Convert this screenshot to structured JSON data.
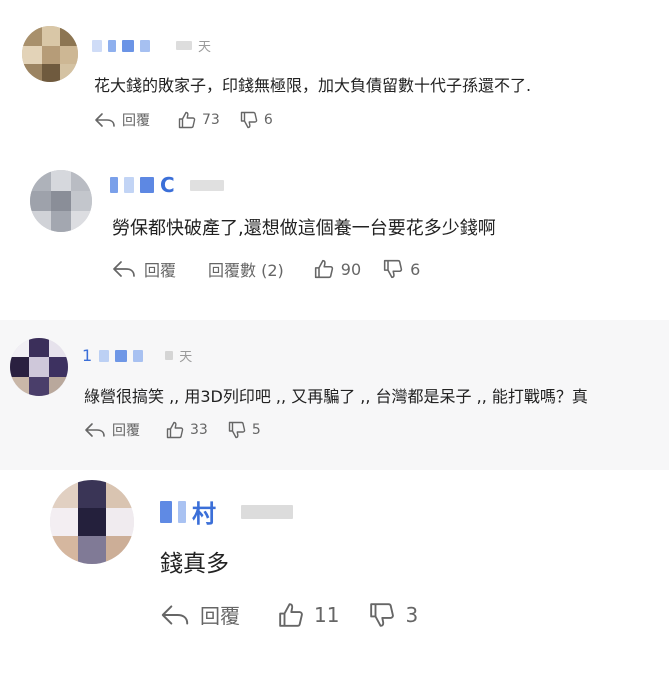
{
  "comments": [
    {
      "user": {
        "name": "",
        "time": "天"
      },
      "text": "花大錢的敗家子，印錢無極限，加大負債留數十代子孫還不了.",
      "reply_label": "回覆",
      "replies_label": "",
      "likes": "73",
      "dislikes": "6"
    },
    {
      "user": {
        "name": "C",
        "time": ""
      },
      "text": "勞保都快破產了,還想做這個養一台要花多少錢啊",
      "reply_label": "回覆",
      "replies_label": "回覆數 (2)",
      "likes": "90",
      "dislikes": "6"
    },
    {
      "user": {
        "name": "1",
        "time": "天"
      },
      "text": "綠營很搞笑 ,, 用3D列印吧 ,, 又再騙了 ,, 台灣都是呆子 ,, 能打戰嗎？真",
      "reply_label": "回覆",
      "replies_label": "",
      "likes": "33",
      "dislikes": "5"
    },
    {
      "user": {
        "name": "村",
        "time": ""
      },
      "text": "錢真多",
      "reply_label": "回覆",
      "replies_label": "",
      "likes": "11",
      "dislikes": "3"
    }
  ],
  "icons": {
    "reply": "reply-arrow-icon",
    "like": "thumbs-up-icon",
    "dislike": "thumbs-down-icon"
  },
  "colors": {
    "name_blue": "#3b6fd8",
    "muted_text": "#666666",
    "body_text": "#222222"
  }
}
